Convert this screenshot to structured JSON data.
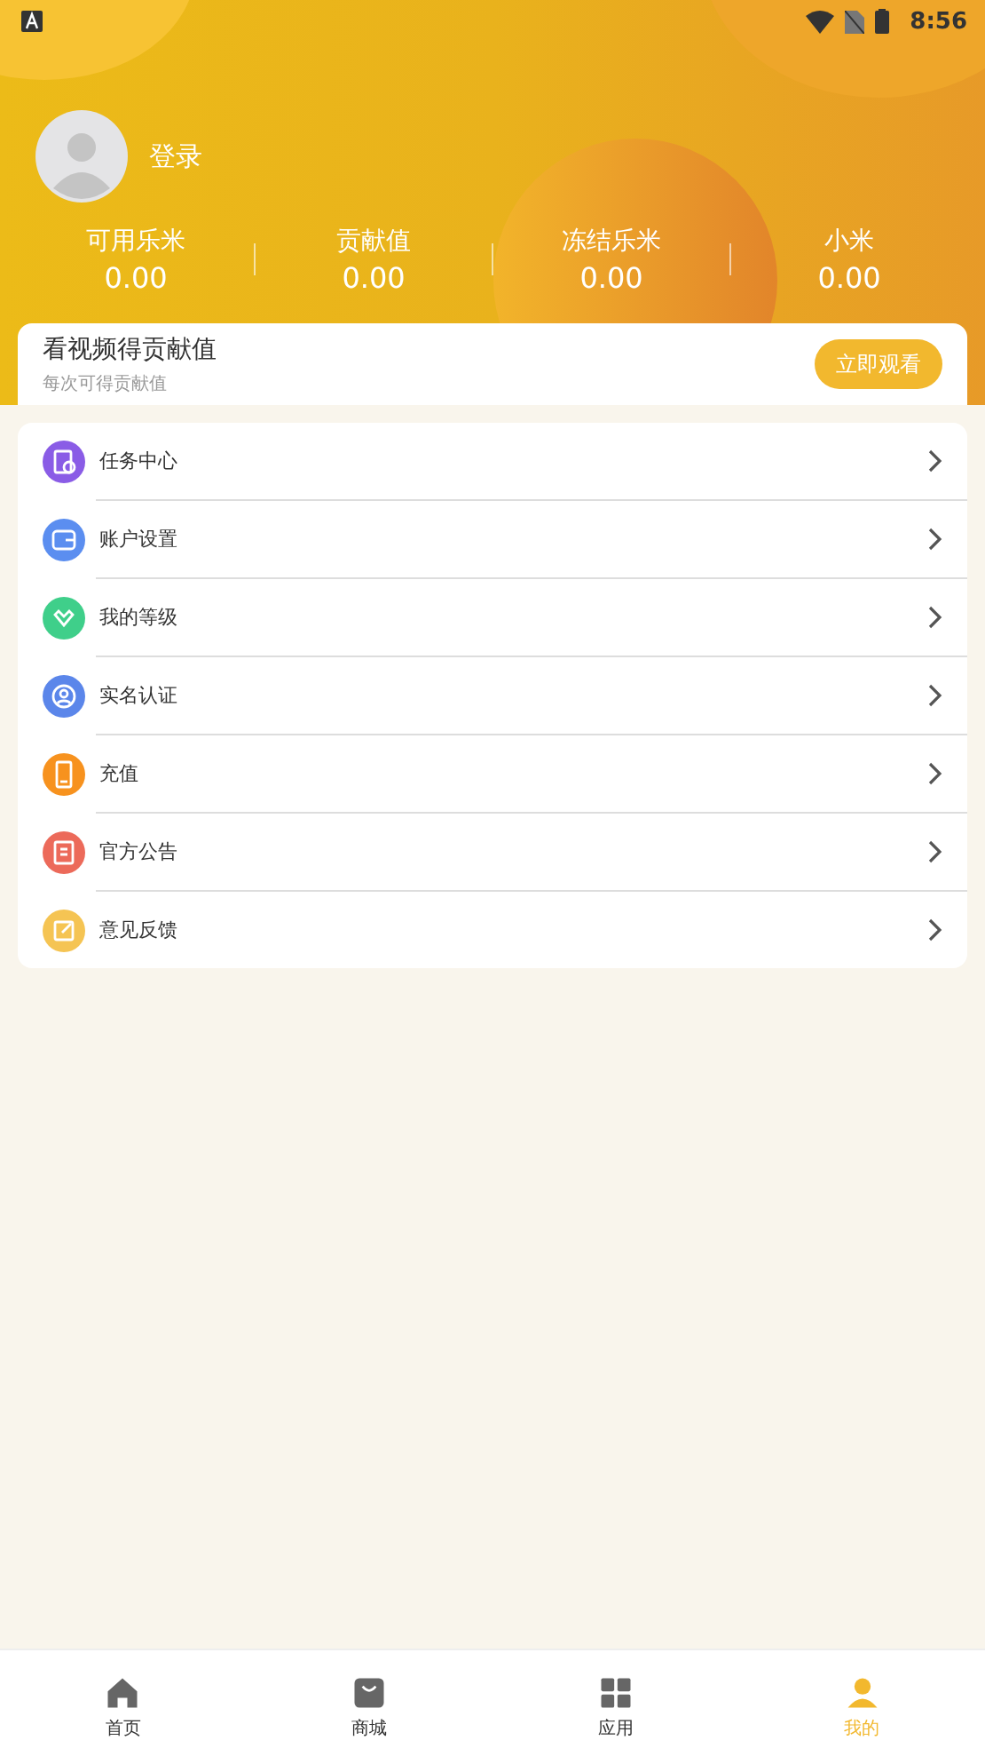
{
  "status_bar": {
    "time": "8:56"
  },
  "profile": {
    "login": "登录"
  },
  "stats": [
    {
      "label": "可用乐米",
      "value": "0.00"
    },
    {
      "label": "贡献值",
      "value": "0.00"
    },
    {
      "label": "冻结乐米",
      "value": "0.00"
    },
    {
      "label": "小米",
      "value": "0.00"
    }
  ],
  "promo": {
    "title": "看视频得贡献值",
    "subtitle": "每次可得贡献值",
    "button": "立即观看"
  },
  "menu": [
    {
      "label": "任务中心",
      "color": "#8a5ce6",
      "kind": "task"
    },
    {
      "label": "账户设置",
      "color": "#5b8ef0",
      "kind": "wallet"
    },
    {
      "label": "我的等级",
      "color": "#3fcf8a",
      "kind": "heart"
    },
    {
      "label": "实名认证",
      "color": "#5b86ea",
      "kind": "user"
    },
    {
      "label": "充值",
      "color": "#f7921e",
      "kind": "phone"
    },
    {
      "label": "官方公告",
      "color": "#ec6a5a",
      "kind": "doc"
    },
    {
      "label": "意见反馈",
      "color": "#f5c453",
      "kind": "edit"
    }
  ],
  "tabs": [
    {
      "label": "首页",
      "kind": "home",
      "selected": false
    },
    {
      "label": "商城",
      "kind": "bag",
      "selected": false
    },
    {
      "label": "应用",
      "kind": "grid",
      "selected": false
    },
    {
      "label": "我的",
      "kind": "person",
      "selected": true
    }
  ]
}
